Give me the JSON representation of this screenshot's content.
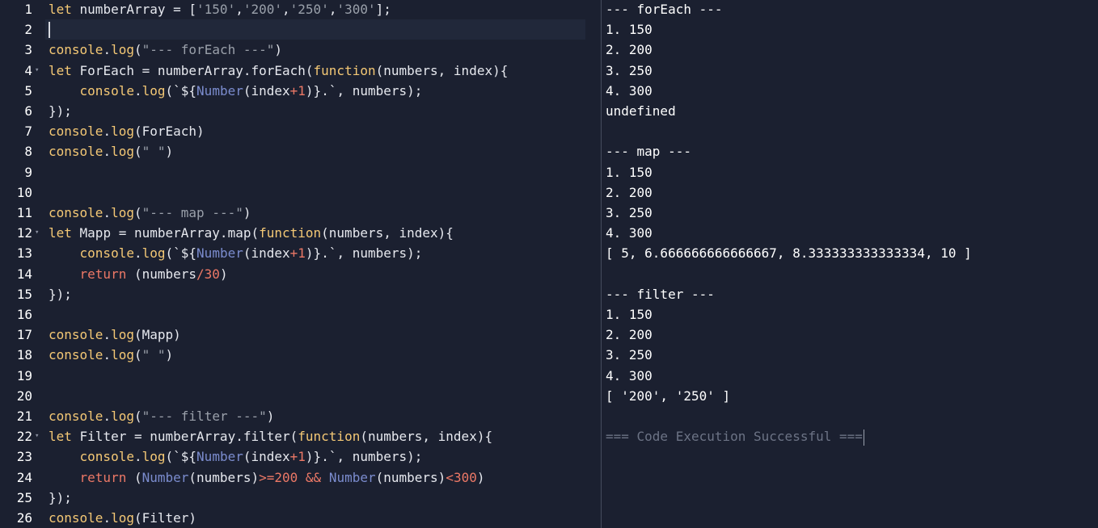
{
  "editor": {
    "active_line": 2,
    "lines": [
      {
        "n": "1",
        "fold": false,
        "tokens": [
          [
            "kw",
            "let"
          ],
          [
            "pl",
            " numberArray = ["
          ],
          [
            "str",
            "'150'"
          ],
          [
            "pl",
            ","
          ],
          [
            "str",
            "'200'"
          ],
          [
            "pl",
            ","
          ],
          [
            "str",
            "'250'"
          ],
          [
            "pl",
            ","
          ],
          [
            "str",
            "'300'"
          ],
          [
            "pl",
            "];"
          ]
        ]
      },
      {
        "n": "2",
        "fold": false,
        "tokens": []
      },
      {
        "n": "3",
        "fold": false,
        "tokens": [
          [
            "fn",
            "console"
          ],
          [
            "pl",
            "."
          ],
          [
            "fn",
            "log"
          ],
          [
            "pl",
            "("
          ],
          [
            "str",
            "\"--- forEach ---\""
          ],
          [
            "pl",
            ")"
          ]
        ]
      },
      {
        "n": "4",
        "fold": true,
        "tokens": [
          [
            "kw",
            "let"
          ],
          [
            "pl",
            " ForEach = numberArray.forEach("
          ],
          [
            "kw",
            "function"
          ],
          [
            "pl",
            "(numbers, index){"
          ]
        ]
      },
      {
        "n": "5",
        "fold": false,
        "tokens": [
          [
            "pl",
            "    "
          ],
          [
            "fn",
            "console"
          ],
          [
            "pl",
            "."
          ],
          [
            "fn",
            "log"
          ],
          [
            "pl",
            "(`${"
          ],
          [
            "builtin",
            "Number"
          ],
          [
            "pl",
            "(index"
          ],
          [
            "op",
            "+"
          ],
          [
            "num",
            "1"
          ],
          [
            "pl",
            ")}.`, numbers);"
          ]
        ]
      },
      {
        "n": "6",
        "fold": false,
        "tokens": [
          [
            "pl",
            "});"
          ]
        ]
      },
      {
        "n": "7",
        "fold": false,
        "tokens": [
          [
            "fn",
            "console"
          ],
          [
            "pl",
            "."
          ],
          [
            "fn",
            "log"
          ],
          [
            "pl",
            "(ForEach)"
          ]
        ]
      },
      {
        "n": "8",
        "fold": false,
        "tokens": [
          [
            "fn",
            "console"
          ],
          [
            "pl",
            "."
          ],
          [
            "fn",
            "log"
          ],
          [
            "pl",
            "("
          ],
          [
            "str",
            "\" \""
          ],
          [
            "pl",
            ")"
          ]
        ]
      },
      {
        "n": "9",
        "fold": false,
        "tokens": []
      },
      {
        "n": "10",
        "fold": false,
        "tokens": []
      },
      {
        "n": "11",
        "fold": false,
        "tokens": [
          [
            "fn",
            "console"
          ],
          [
            "pl",
            "."
          ],
          [
            "fn",
            "log"
          ],
          [
            "pl",
            "("
          ],
          [
            "str",
            "\"--- map ---\""
          ],
          [
            "pl",
            ")"
          ]
        ]
      },
      {
        "n": "12",
        "fold": true,
        "tokens": [
          [
            "kw",
            "let"
          ],
          [
            "pl",
            " Mapp = numberArray.map("
          ],
          [
            "kw",
            "function"
          ],
          [
            "pl",
            "(numbers, index){"
          ]
        ]
      },
      {
        "n": "13",
        "fold": false,
        "tokens": [
          [
            "pl",
            "    "
          ],
          [
            "fn",
            "console"
          ],
          [
            "pl",
            "."
          ],
          [
            "fn",
            "log"
          ],
          [
            "pl",
            "(`${"
          ],
          [
            "builtin",
            "Number"
          ],
          [
            "pl",
            "(index"
          ],
          [
            "op",
            "+"
          ],
          [
            "num",
            "1"
          ],
          [
            "pl",
            ")}.`, numbers);"
          ]
        ]
      },
      {
        "n": "14",
        "fold": false,
        "tokens": [
          [
            "pl",
            "    "
          ],
          [
            "num",
            "return"
          ],
          [
            "pl",
            " (numbers"
          ],
          [
            "op",
            "/"
          ],
          [
            "num",
            "30"
          ],
          [
            "pl",
            ")"
          ]
        ]
      },
      {
        "n": "15",
        "fold": false,
        "tokens": [
          [
            "pl",
            "});"
          ]
        ]
      },
      {
        "n": "16",
        "fold": false,
        "tokens": []
      },
      {
        "n": "17",
        "fold": false,
        "tokens": [
          [
            "fn",
            "console"
          ],
          [
            "pl",
            "."
          ],
          [
            "fn",
            "log"
          ],
          [
            "pl",
            "(Mapp)"
          ]
        ]
      },
      {
        "n": "18",
        "fold": false,
        "tokens": [
          [
            "fn",
            "console"
          ],
          [
            "pl",
            "."
          ],
          [
            "fn",
            "log"
          ],
          [
            "pl",
            "("
          ],
          [
            "str",
            "\" \""
          ],
          [
            "pl",
            ")"
          ]
        ]
      },
      {
        "n": "19",
        "fold": false,
        "tokens": []
      },
      {
        "n": "20",
        "fold": false,
        "tokens": []
      },
      {
        "n": "21",
        "fold": false,
        "tokens": [
          [
            "fn",
            "console"
          ],
          [
            "pl",
            "."
          ],
          [
            "fn",
            "log"
          ],
          [
            "pl",
            "("
          ],
          [
            "str",
            "\"--- filter ---\""
          ],
          [
            "pl",
            ")"
          ]
        ]
      },
      {
        "n": "22",
        "fold": true,
        "tokens": [
          [
            "kw",
            "let"
          ],
          [
            "pl",
            " Filter = numberArray.filter("
          ],
          [
            "kw",
            "function"
          ],
          [
            "pl",
            "(numbers, index){"
          ]
        ]
      },
      {
        "n": "23",
        "fold": false,
        "tokens": [
          [
            "pl",
            "    "
          ],
          [
            "fn",
            "console"
          ],
          [
            "pl",
            "."
          ],
          [
            "fn",
            "log"
          ],
          [
            "pl",
            "(`${"
          ],
          [
            "builtin",
            "Number"
          ],
          [
            "pl",
            "(index"
          ],
          [
            "op",
            "+"
          ],
          [
            "num",
            "1"
          ],
          [
            "pl",
            ")}.`, numbers);"
          ]
        ]
      },
      {
        "n": "24",
        "fold": false,
        "tokens": [
          [
            "pl",
            "    "
          ],
          [
            "num",
            "return"
          ],
          [
            "pl",
            " ("
          ],
          [
            "builtin",
            "Number"
          ],
          [
            "pl",
            "(numbers)"
          ],
          [
            "op",
            ">="
          ],
          [
            "num",
            "200"
          ],
          [
            "pl",
            " "
          ],
          [
            "op",
            "&&"
          ],
          [
            "pl",
            " "
          ],
          [
            "builtin",
            "Number"
          ],
          [
            "pl",
            "(numbers)"
          ],
          [
            "op",
            "<"
          ],
          [
            "num",
            "300"
          ],
          [
            "pl",
            ")"
          ]
        ]
      },
      {
        "n": "25",
        "fold": false,
        "tokens": [
          [
            "pl",
            "});"
          ]
        ]
      },
      {
        "n": "26",
        "fold": false,
        "tokens": [
          [
            "fn",
            "console"
          ],
          [
            "pl",
            "."
          ],
          [
            "fn",
            "log"
          ],
          [
            "pl",
            "(Filter)"
          ]
        ]
      }
    ]
  },
  "output": {
    "lines": [
      {
        "text": "--- forEach ---",
        "dim": false
      },
      {
        "text": "1. 150",
        "dim": false
      },
      {
        "text": "2. 200",
        "dim": false
      },
      {
        "text": "3. 250",
        "dim": false
      },
      {
        "text": "4. 300",
        "dim": false
      },
      {
        "text": "undefined",
        "dim": false
      },
      {
        "text": " ",
        "dim": false
      },
      {
        "text": "--- map ---",
        "dim": false
      },
      {
        "text": "1. 150",
        "dim": false
      },
      {
        "text": "2. 200",
        "dim": false
      },
      {
        "text": "3. 250",
        "dim": false
      },
      {
        "text": "4. 300",
        "dim": false
      },
      {
        "text": "[ 5, 6.666666666666667, 8.333333333333334, 10 ]",
        "dim": false
      },
      {
        "text": " ",
        "dim": false
      },
      {
        "text": "--- filter ---",
        "dim": false
      },
      {
        "text": "1. 150",
        "dim": false
      },
      {
        "text": "2. 200",
        "dim": false
      },
      {
        "text": "3. 250",
        "dim": false
      },
      {
        "text": "4. 300",
        "dim": false
      },
      {
        "text": "[ '200', '250' ]",
        "dim": false
      },
      {
        "text": " ",
        "dim": false
      },
      {
        "text": "=== Code Execution Successful ===",
        "dim": true
      }
    ]
  }
}
